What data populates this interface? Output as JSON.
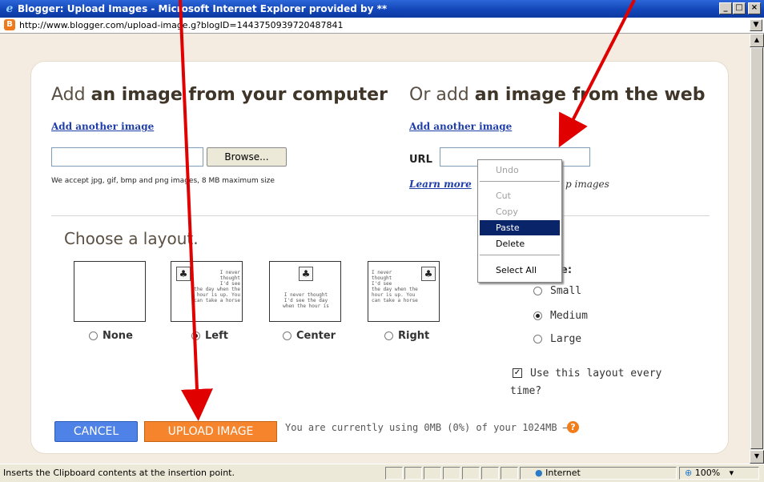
{
  "window": {
    "title": "Blogger: Upload Images - Microsoft Internet Explorer provided by **",
    "controls": [
      "_",
      "□",
      "×"
    ]
  },
  "address": {
    "url": "http://www.blogger.com/upload-image.g?blogID=1443750939720487841",
    "dropdown": "▼"
  },
  "left_section": {
    "title_prefix": "Add ",
    "title_bold": "an image from your computer",
    "add_link": "Add another image",
    "browse_label": "Browse...",
    "accept_note": "We accept jpg, gif, bmp and png images, 8 MB maximum size"
  },
  "right_section": {
    "title_prefix": "Or add ",
    "title_bold": "an image from the web",
    "add_link": "Add another image",
    "url_label": "URL",
    "learn_more": "Learn more",
    "learn_more_suffix": "p images"
  },
  "layout": {
    "heading": "Choose a layout.",
    "options": [
      {
        "label": "None",
        "selected": false
      },
      {
        "label": "Left",
        "selected": true
      },
      {
        "label": "Center",
        "selected": false
      },
      {
        "label": "Right",
        "selected": false
      }
    ],
    "thumb_text": {
      "left": "I never\nthought\nI'd see\nthe day when the\nhour is up. You\ncan take a horse",
      "center": "I never thought\nI'd see the day\nwhen the hour is",
      "right": "I never\nthought\nI'd see\nthe day when the\nhour is up. You\ncan take a horse"
    }
  },
  "image_size": {
    "heading_suffix": "e:",
    "options": [
      {
        "label": "Small",
        "selected": false
      },
      {
        "label": "Medium",
        "selected": true
      },
      {
        "label": "Large",
        "selected": false
      }
    ]
  },
  "remember": {
    "checked": true,
    "label_line1": "Use this layout every",
    "label_line2": "time?"
  },
  "actions": {
    "cancel": "CANCEL",
    "upload": "UPLOAD IMAGE",
    "usage": "You are currently using 0MB (0%) of your 1024MB –",
    "help": "?"
  },
  "context_menu": {
    "items": [
      {
        "label": "Undo",
        "enabled": false
      },
      {
        "label": "Cut",
        "enabled": false
      },
      {
        "label": "Copy",
        "enabled": false
      },
      {
        "label": "Paste",
        "enabled": true,
        "highlighted": true
      },
      {
        "label": "Delete",
        "enabled": true
      },
      {
        "label": "Select All",
        "enabled": true
      }
    ]
  },
  "status": {
    "text": "Inserts the Clipboard contents at the insertion point.",
    "zone": "Internet",
    "zoom": "100%"
  },
  "colors": {
    "title_bar": "#1346b8",
    "cancel": "#4f82e6",
    "upload": "#f5842c",
    "arrow": "#e00000",
    "menu_highlight": "#0a246a"
  }
}
